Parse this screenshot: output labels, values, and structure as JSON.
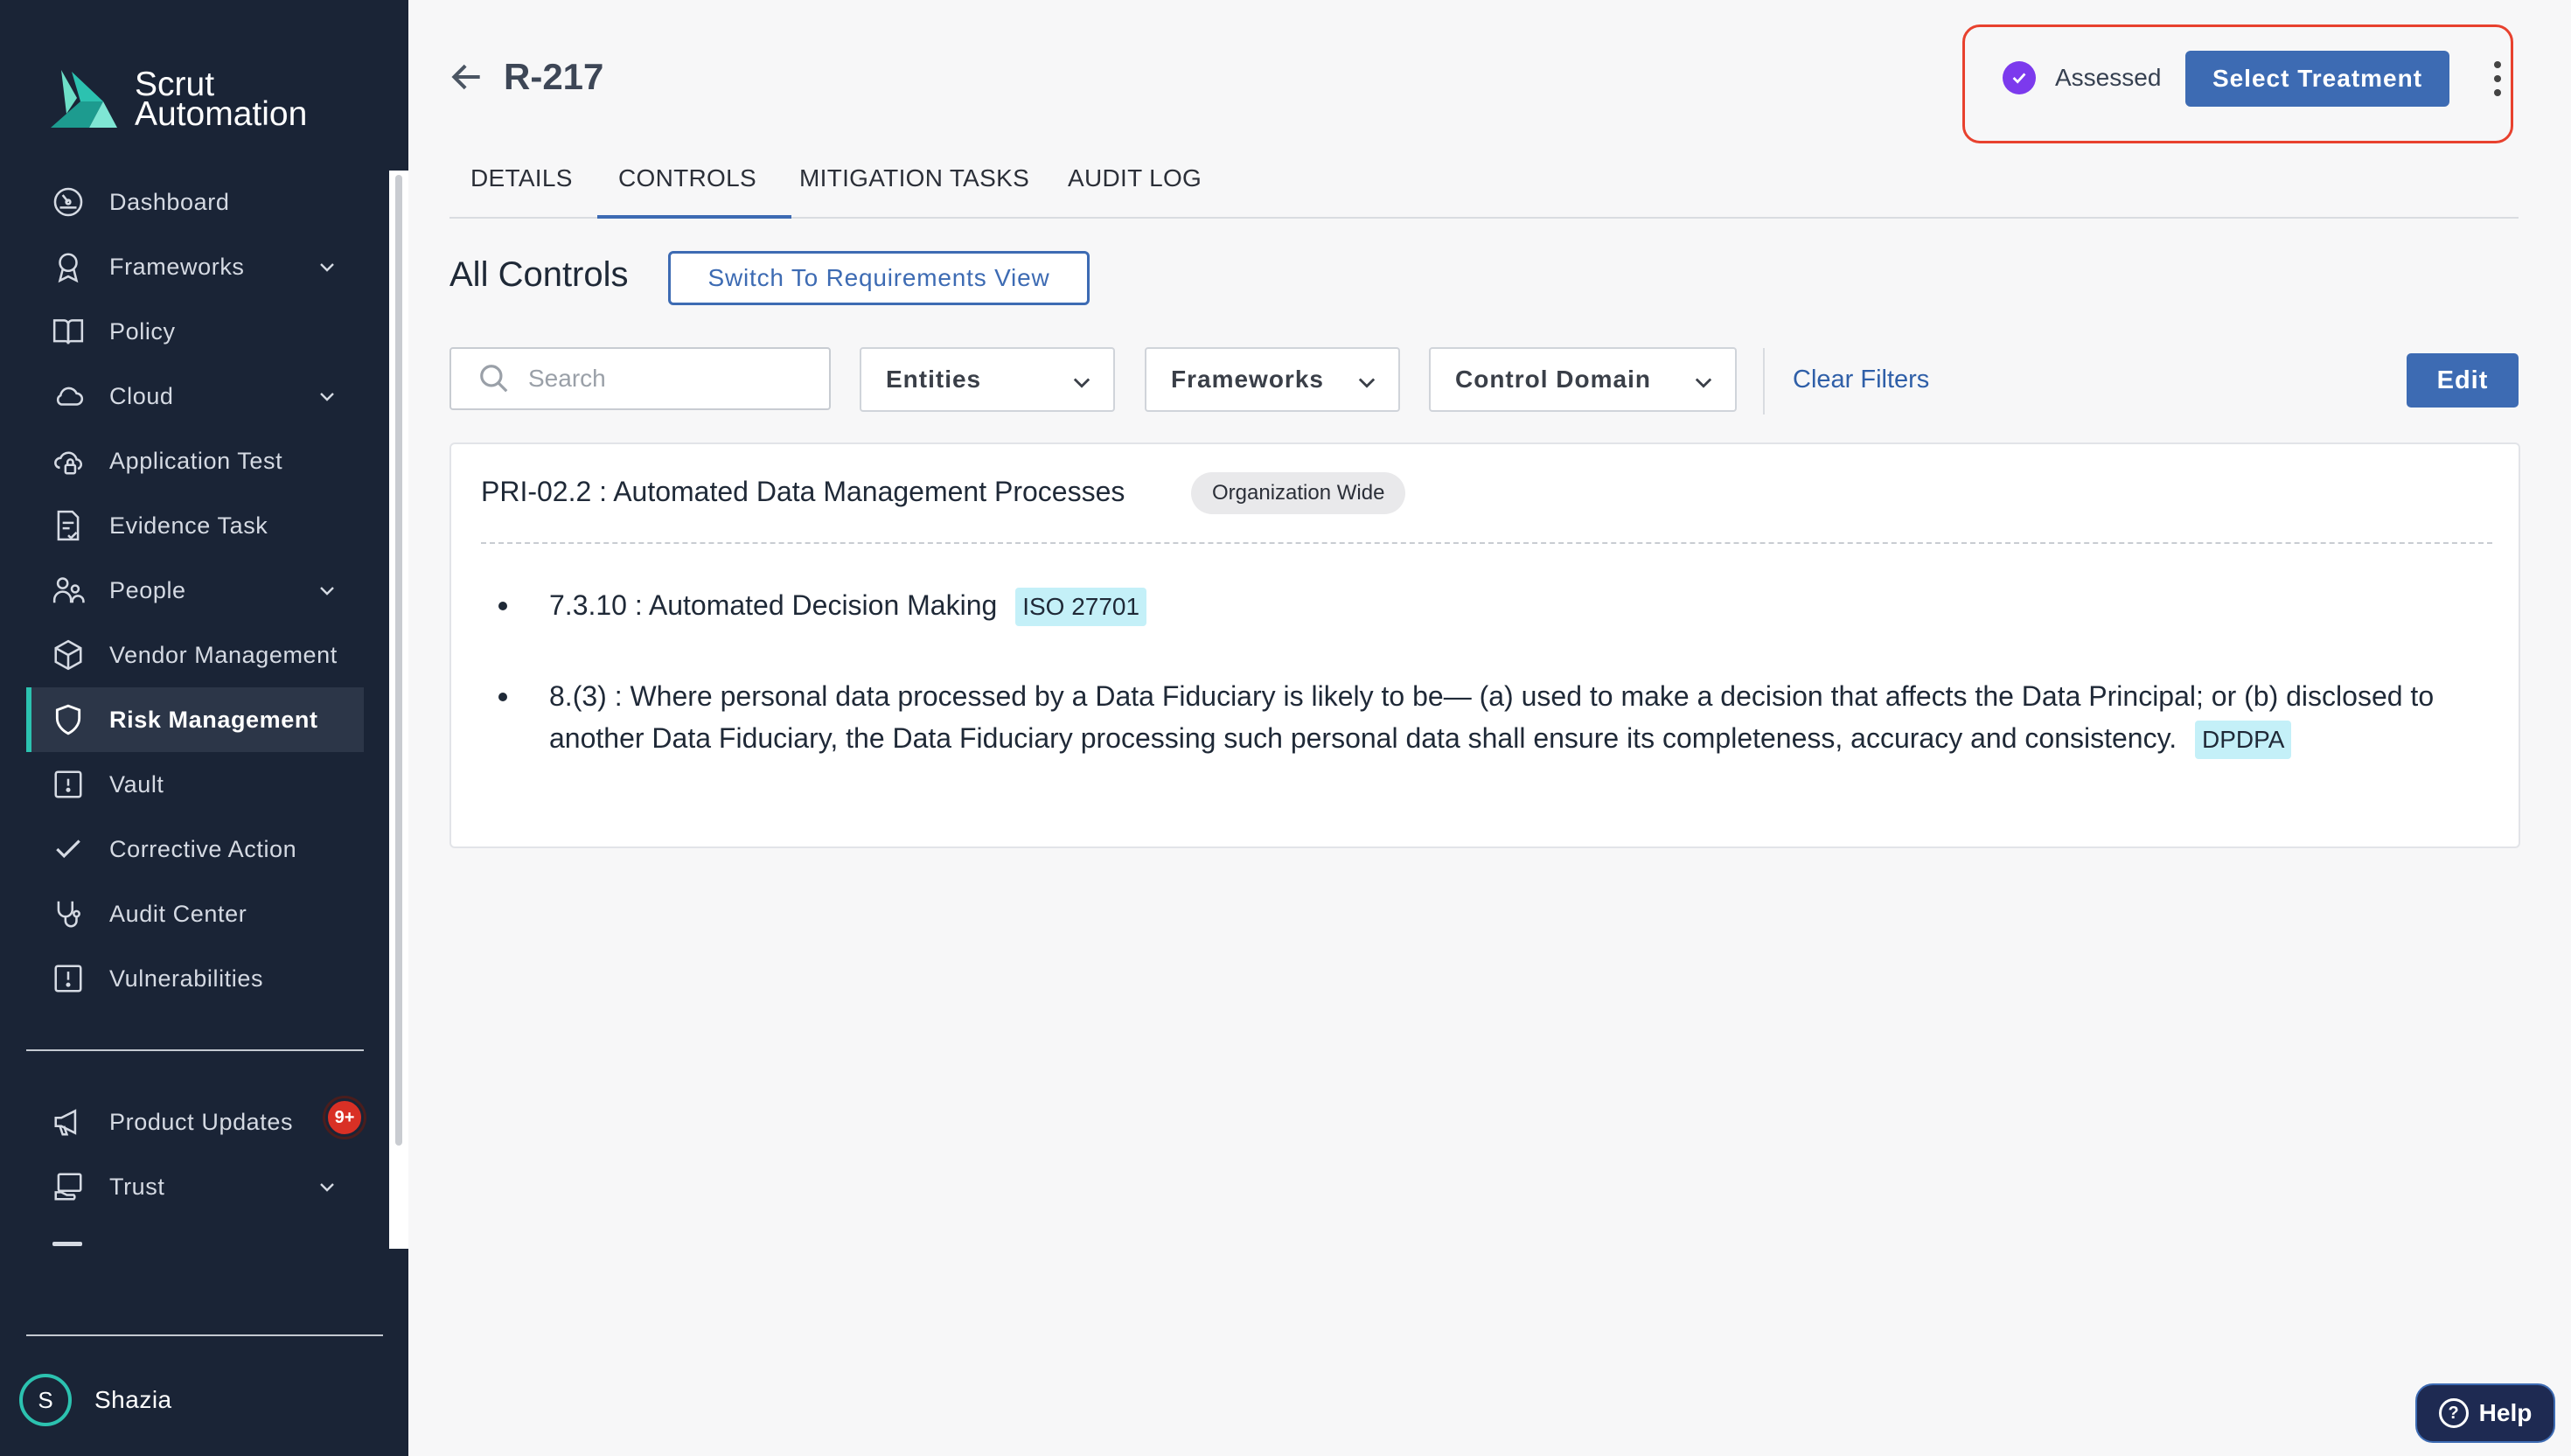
{
  "app": {
    "brand_line1": "Scrut",
    "brand_line2": "Automation",
    "accent_color": "#3d6bb3",
    "brand_color": "#2cc2b0",
    "sidebar_bg": "#1a2436"
  },
  "sidebar": {
    "items": [
      {
        "label": "Dashboard",
        "icon": "dashboard-icon"
      },
      {
        "label": "Frameworks",
        "icon": "award-icon",
        "expandable": true
      },
      {
        "label": "Policy",
        "icon": "book-icon"
      },
      {
        "label": "Cloud",
        "icon": "cloud-icon",
        "expandable": true
      },
      {
        "label": "Application Test",
        "icon": "cloud-lock-icon"
      },
      {
        "label": "Evidence Task",
        "icon": "document-check-icon"
      },
      {
        "label": "People",
        "icon": "people-icon",
        "expandable": true
      },
      {
        "label": "Vendor Management",
        "icon": "box-icon"
      },
      {
        "label": "Risk Management",
        "icon": "shield-icon",
        "active": true
      },
      {
        "label": "Vault",
        "icon": "vault-icon"
      },
      {
        "label": "Corrective Action",
        "icon": "check-icon"
      },
      {
        "label": "Audit Center",
        "icon": "stethoscope-icon"
      },
      {
        "label": "Vulnerabilities",
        "icon": "alert-square-icon"
      }
    ],
    "bottom_items": [
      {
        "label": "Product Updates",
        "icon": "megaphone-icon",
        "badge": "9+"
      },
      {
        "label": "Trust",
        "icon": "trust-icon",
        "expandable": true
      }
    ],
    "user": {
      "initial": "S",
      "name": "Shazia"
    }
  },
  "header": {
    "title": "R-217",
    "status_label": "Assessed",
    "primary_action": "Select Treatment"
  },
  "tabs": [
    {
      "label": "DETAILS",
      "active": false
    },
    {
      "label": "CONTROLS",
      "active": true
    },
    {
      "label": "MITIGATION TASKS",
      "active": false
    },
    {
      "label": "AUDIT LOG",
      "active": false
    }
  ],
  "controls": {
    "section_title": "All Controls",
    "switch_view_label": "Switch To Requirements View",
    "search_placeholder": "Search",
    "filters": [
      "Entities",
      "Frameworks",
      "Control Domain"
    ],
    "clear_filters": "Clear Filters",
    "edit_label": "Edit",
    "card": {
      "title": "PRI-02.2 : Automated Data Management Processes",
      "scope_chip": "Organization Wide",
      "requirements": [
        {
          "code": "7.3.10",
          "text": "Automated Decision Making",
          "framework": "ISO 27701"
        },
        {
          "code": "8.(3)",
          "text": "Where personal data processed by a Data Fiduciary is likely to be— (a) used to make a decision that affects the Data Principal; or (b) disclosed to another Data Fiduciary, the Data Fiduciary processing such personal data shall ensure its completeness, accuracy and consistency.",
          "framework": "DPDPA"
        }
      ]
    }
  },
  "help": {
    "label": "Help"
  }
}
